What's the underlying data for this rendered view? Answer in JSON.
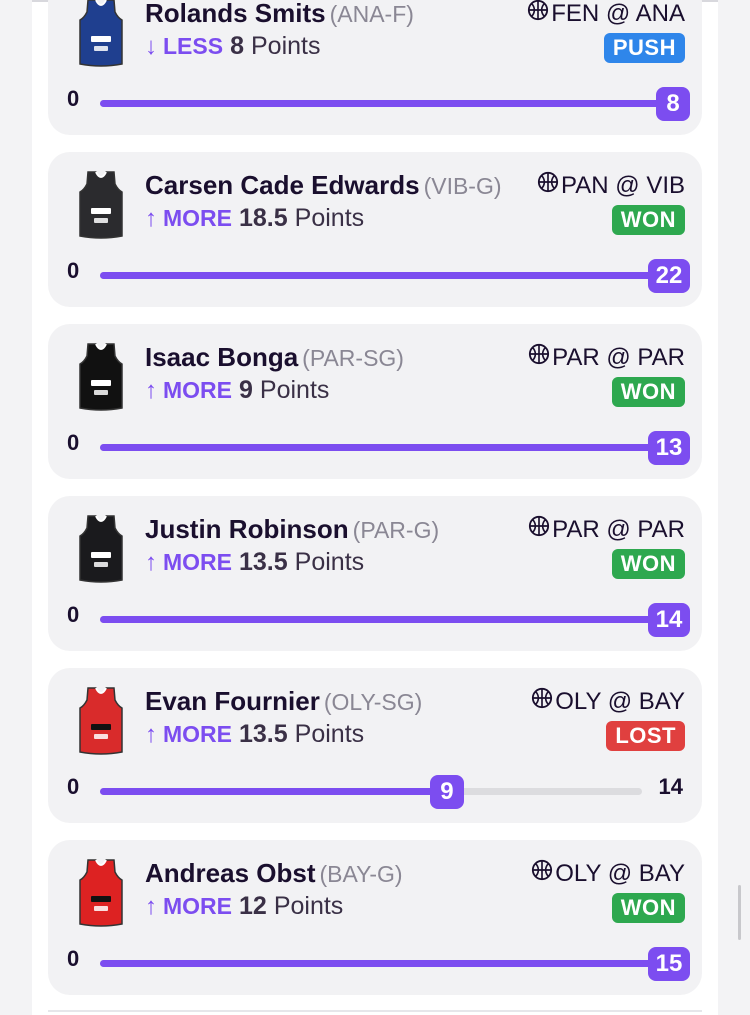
{
  "colors": {
    "accent": "#7c4df0",
    "push": "#2f86ea",
    "won": "#2ea84f",
    "lost": "#e0403f",
    "card_bg": "#f2f2f4"
  },
  "picks": [
    {
      "player": "Rolands Smits",
      "team_pos": "(ANA-F)",
      "direction_icon": "arrow-down-icon",
      "direction_arrow": "↓",
      "direction": "LESS",
      "line": "8",
      "stat": "Points",
      "matchup": "FEN @ ANA",
      "status": "PUSH",
      "status_color": "#2f86ea",
      "bar_min": "0",
      "result": "8",
      "progress": 1.0,
      "bar_max": "",
      "jersey_color": "#1f3f8f"
    },
    {
      "player": "Carsen Cade Edwards",
      "team_pos": "(VIB-G)",
      "direction_icon": "arrow-up-icon",
      "direction_arrow": "↑",
      "direction": "MORE",
      "line": "18.5",
      "stat": "Points",
      "matchup": "PAN @ VIB",
      "status": "WON",
      "status_color": "#2ea84f",
      "bar_min": "0",
      "result": "22",
      "progress": 1.0,
      "bar_max": "",
      "jersey_color": "#2b2b2e"
    },
    {
      "player": "Isaac Bonga",
      "team_pos": "(PAR-SG)",
      "direction_icon": "arrow-up-icon",
      "direction_arrow": "↑",
      "direction": "MORE",
      "line": "9",
      "stat": "Points",
      "matchup": "PAR @ PAR",
      "status": "WON",
      "status_color": "#2ea84f",
      "bar_min": "0",
      "result": "13",
      "progress": 1.0,
      "bar_max": "",
      "jersey_color": "#111111"
    },
    {
      "player": "Justin Robinson",
      "team_pos": "(PAR-G)",
      "direction_icon": "arrow-up-icon",
      "direction_arrow": "↑",
      "direction": "MORE",
      "line": "13.5",
      "stat": "Points",
      "matchup": "PAR @ PAR",
      "status": "WON",
      "status_color": "#2ea84f",
      "bar_min": "0",
      "result": "14",
      "progress": 1.0,
      "bar_max": "",
      "jersey_color": "#1a1a1d"
    },
    {
      "player": "Evan Fournier",
      "team_pos": "(OLY-SG)",
      "direction_icon": "arrow-up-icon",
      "direction_arrow": "↑",
      "direction": "MORE",
      "line": "13.5",
      "stat": "Points",
      "matchup": "OLY @ BAY",
      "status": "LOST",
      "status_color": "#e0403f",
      "bar_min": "0",
      "result": "9",
      "progress": 0.64,
      "bar_max": "14",
      "jersey_color": "#d92b2b"
    },
    {
      "player": "Andreas Obst",
      "team_pos": "(BAY-G)",
      "direction_icon": "arrow-up-icon",
      "direction_arrow": "↑",
      "direction": "MORE",
      "line": "12",
      "stat": "Points",
      "matchup": "OLY @ BAY",
      "status": "WON",
      "status_color": "#2ea84f",
      "bar_min": "0",
      "result": "15",
      "progress": 1.0,
      "bar_max": "",
      "jersey_color": "#dd2222"
    }
  ]
}
